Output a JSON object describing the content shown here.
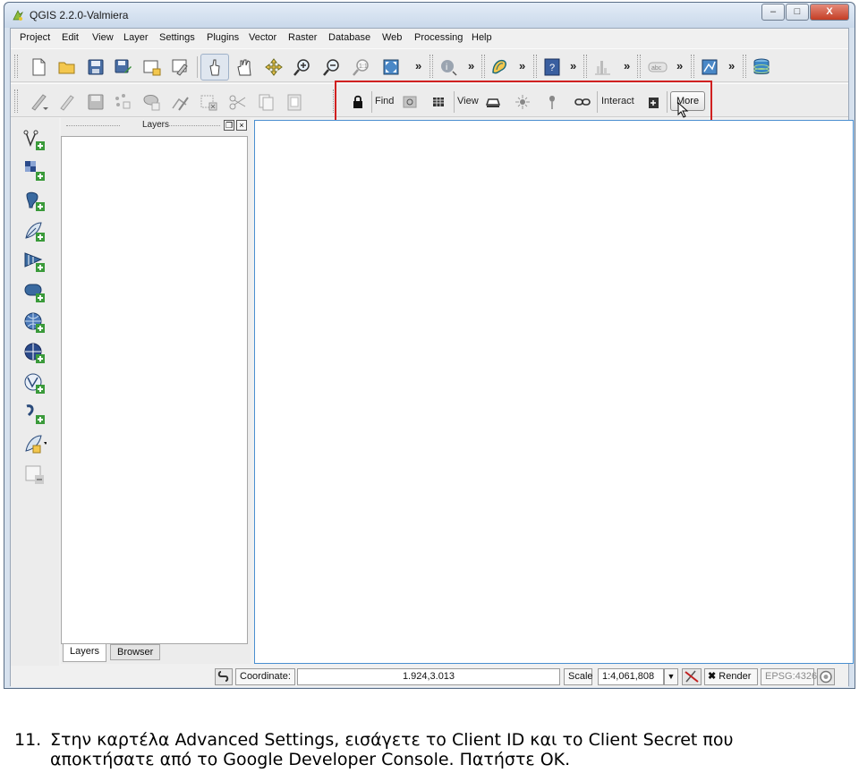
{
  "window": {
    "title": "QGIS 2.2.0-Valmiera",
    "minimize": "‒",
    "maximize": "□",
    "close": "X"
  },
  "menu": [
    {
      "id": "project",
      "label": "Project"
    },
    {
      "id": "edit",
      "label": "Edit"
    },
    {
      "id": "view",
      "label": "View"
    },
    {
      "id": "layer",
      "label": "Layer"
    },
    {
      "id": "settings",
      "label": "Settings"
    },
    {
      "id": "plugins",
      "label": "Plugins"
    },
    {
      "id": "vector",
      "label": "Vector"
    },
    {
      "id": "raster",
      "label": "Raster"
    },
    {
      "id": "database",
      "label": "Database"
    },
    {
      "id": "web",
      "label": "Web"
    },
    {
      "id": "processing",
      "label": "Processing"
    },
    {
      "id": "help",
      "label": "Help"
    }
  ],
  "toolbar1": {
    "overflow": "»",
    "icons": [
      "new-project-icon",
      "open-project-icon",
      "save-project-icon",
      "save-as-icon",
      "new-print-composer-icon",
      "composer-manager-icon",
      "touch-zoom-icon",
      "pan-icon",
      "pan-to-selection-icon",
      "zoom-in-icon",
      "zoom-out-icon",
      "zoom-native-icon",
      "zoom-full-icon",
      "identify-icon",
      "measure-icon",
      "help-icon",
      "histogram-icon",
      "label-icon",
      "georeferencer-icon",
      "db-manager-icon"
    ]
  },
  "toolbar2": {
    "icons": [
      "digitize-icon",
      "pencil-icon",
      "save-edits-icon",
      "add-feature-icon",
      "move-feature-icon",
      "node-tool-icon",
      "delete-selected-icon",
      "cut-icon",
      "copy-icon",
      "paste-icon"
    ],
    "openlayers": {
      "lock_icon": "lock-icon",
      "find_label": "Find",
      "view_label": "View",
      "interact_label": "Interact",
      "more_label": "More"
    }
  },
  "left_toolbar": {
    "icons": [
      "add-vector-layer-icon",
      "add-raster-layer-icon",
      "add-postgis-layer-icon",
      "add-spatialite-layer-icon",
      "add-mssql-layer-icon",
      "add-oracle-layer-icon",
      "add-wms-layer-icon",
      "add-wcs-layer-icon",
      "add-wfs-layer-icon",
      "add-delimited-text-icon",
      "new-shapefile-icon",
      "remove-layer-icon"
    ]
  },
  "layers_panel": {
    "title": "Layers",
    "float_btn": "❐",
    "close_btn": "×",
    "tabs": [
      {
        "id": "layers",
        "label": "Layers"
      },
      {
        "id": "browser",
        "label": "Browser"
      }
    ]
  },
  "statusbar": {
    "coordinate_label": "Coordinate:",
    "coordinate_value": "1.924,3.013",
    "scale_label": "Scale",
    "scale_value": "1:4,061,808",
    "render_label": "Render",
    "crs_label": "EPSG:4326"
  },
  "caption": {
    "number": "11.",
    "line1": "Στην καρτέλα Advanced Settings, εισάγετε το Client ID και το Client Secret που",
    "line2": "αποκτήσατε από το Google Developer Console. Πατήστε ΟΚ."
  },
  "colors": {
    "highlight": "#d02020",
    "canvas_border": "#4a8fd0",
    "title_bar": "#c9d8ea"
  }
}
